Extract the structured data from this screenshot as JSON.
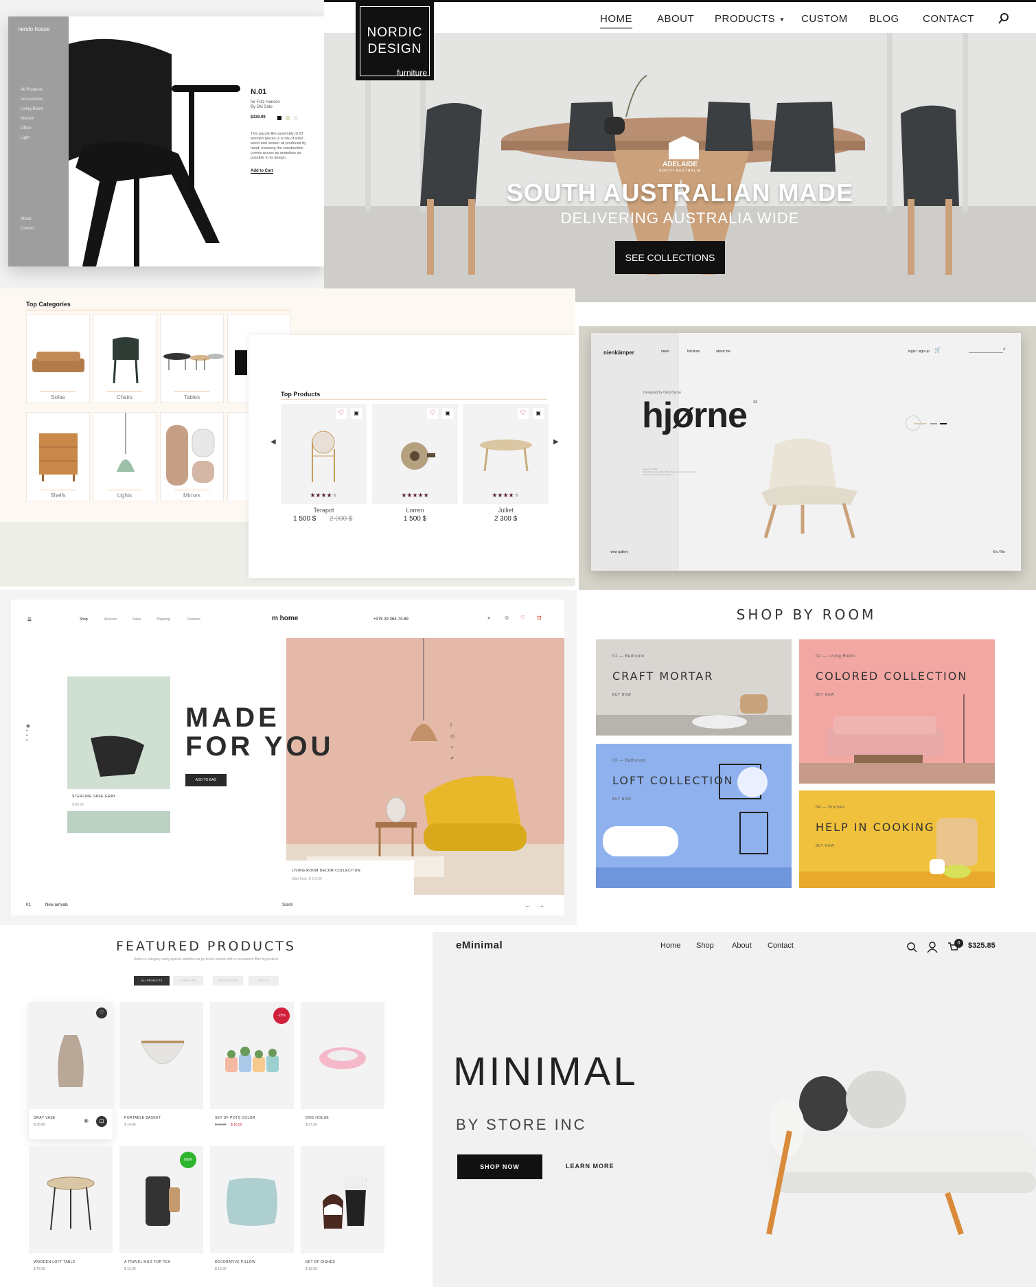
{
  "nendo": {
    "brand": "nendo house",
    "menu": [
      "All Products",
      "Accessories",
      "Living Room",
      "Kitchen",
      "Office",
      "Light"
    ],
    "footer_menu": [
      "About",
      "Contact"
    ],
    "product_title": "N.01",
    "designer": "for Fritz Hansen",
    "designer2": "By Oki Sato",
    "price": "$339.99",
    "description": [
      "This puzzle-like assembly of 23",
      "wooden pieces is a mix of solid",
      "wood and veneer all produced by",
      "hand, ensuring the construction",
      "comes across as seamless as",
      "possible in its design."
    ],
    "cart": "Add to Cart"
  },
  "nordic": {
    "logo_line1": "NORDIC",
    "logo_line2": "DESIGN",
    "logo_line3": "furniture",
    "nav": [
      "HOME",
      "ABOUT",
      "PRODUCTS",
      "CUSTOM",
      "BLOG",
      "CONTACT"
    ],
    "badge": "ADELAIDE",
    "badge_sub": "SOUTH AUSTRALIA",
    "headline": "SOUTH AUSTRALIAN MADE",
    "subheadline": "DELIVERING AUSTRALIA WIDE",
    "cta": "SEE COLLECTIONS"
  },
  "categories": {
    "title": "Top Categories",
    "items": [
      "Sofas",
      "Chairs",
      "Tables",
      "Shelfs",
      "Lights",
      "Mirrors"
    ]
  },
  "top_products": {
    "title": "Top Products",
    "items": [
      {
        "name": "Terapot",
        "price": "1 500 $",
        "old_price": "2 000 $",
        "rating": 4
      },
      {
        "name": "Lorren",
        "price": "1 500 $",
        "old_price": "",
        "rating": 5
      },
      {
        "name": "Julliet",
        "price": "2 300 $",
        "old_price": "",
        "rating": 4
      }
    ]
  },
  "hjorne": {
    "brand": "nienkämper",
    "nav": [
      "news",
      "furniture",
      "about me"
    ],
    "account": "login / sign up",
    "headline": "hjørne",
    "sup": "24",
    "designed_by": "Designed by Oleg Backe",
    "view_gallery": "view gallery",
    "lang": "En / No"
  },
  "myhome": {
    "nav": [
      "Shop",
      "Services",
      "Sales",
      "Shipping",
      "Contacts"
    ],
    "logo": "m home",
    "phone": "+375 29 364-74-69",
    "headline1": "MADE",
    "headline2": "FOR YOU",
    "cta": "ADD TO BAG",
    "product_name": "STERLING VASE GRAY",
    "product_price": "$ 84.99",
    "collection": "LIVING ROOM DECOR COLLECTION",
    "collection_price": "Start from: $ 119.99",
    "counter": "01",
    "arrivals": "New arrivals",
    "scroll": "Scroll"
  },
  "rooms": {
    "title": "SHOP BY ROOM",
    "buy_now": "BUY NOW",
    "items": [
      {
        "num": "01",
        "room": "Bedroom",
        "title": "CRAFT MORTAR"
      },
      {
        "num": "02",
        "room": "Living Room",
        "title": "COLORED COLLECTION"
      },
      {
        "num": "03",
        "room": "Bathroom",
        "title": "LOFT COLLECTION"
      },
      {
        "num": "04",
        "room": "Kitchen",
        "title": "HELP IN COOKING"
      }
    ]
  },
  "featured": {
    "title": "FEATURED PRODUCTS",
    "subtitle": "Select a category using special switches as go to the section with a convenient filter by product",
    "tabs": [
      "ALL PRODUCTS",
      "FURNITURE",
      "ACCESSORIES",
      "TEXTILE"
    ],
    "items": [
      {
        "name": "GRAY VASE",
        "price": "$ 38.99",
        "old": "",
        "badge": ""
      },
      {
        "name": "PORTABLE BASKET",
        "price": "$ 14.99",
        "old": "",
        "badge": ""
      },
      {
        "name": "SET OF POTS COLOR",
        "price": "$ 16.50",
        "old": "$ 41.99",
        "badge": "-25%"
      },
      {
        "name": "DOG HOUSE",
        "price": "$ 37.99",
        "old": "",
        "badge": ""
      },
      {
        "name": "WOODEN LOFT TABLE",
        "price": "$ 78.99",
        "old": "",
        "badge": ""
      },
      {
        "name": "A TRAVEL MUG FOR TEA",
        "price": "$ 15.99",
        "old": "",
        "badge": "NEW"
      },
      {
        "name": "DECORATIVE PILLOW",
        "price": "$ 12.99",
        "old": "",
        "badge": ""
      },
      {
        "name": "SET OF DISHES",
        "price": "$ 18.99",
        "old": "",
        "badge": ""
      }
    ]
  },
  "eminimal": {
    "brand": "eMinimal",
    "nav": [
      "Home",
      "Shop",
      "About",
      "Contact"
    ],
    "cart_count": "0",
    "cart_total": "$325.85",
    "headline": "MINIMAL",
    "sub": "BY STORE INC",
    "cta": "SHOP NOW",
    "learn": "LEARN MORE"
  },
  "colors": {
    "accent_dark": "#111111",
    "rating": "#5a1a3a",
    "badge_red": "#d0203a",
    "badge_green": "#2db52d",
    "pink": "#f3a7a3",
    "blue": "#8fb2ee",
    "yellow": "#f0c13c"
  }
}
